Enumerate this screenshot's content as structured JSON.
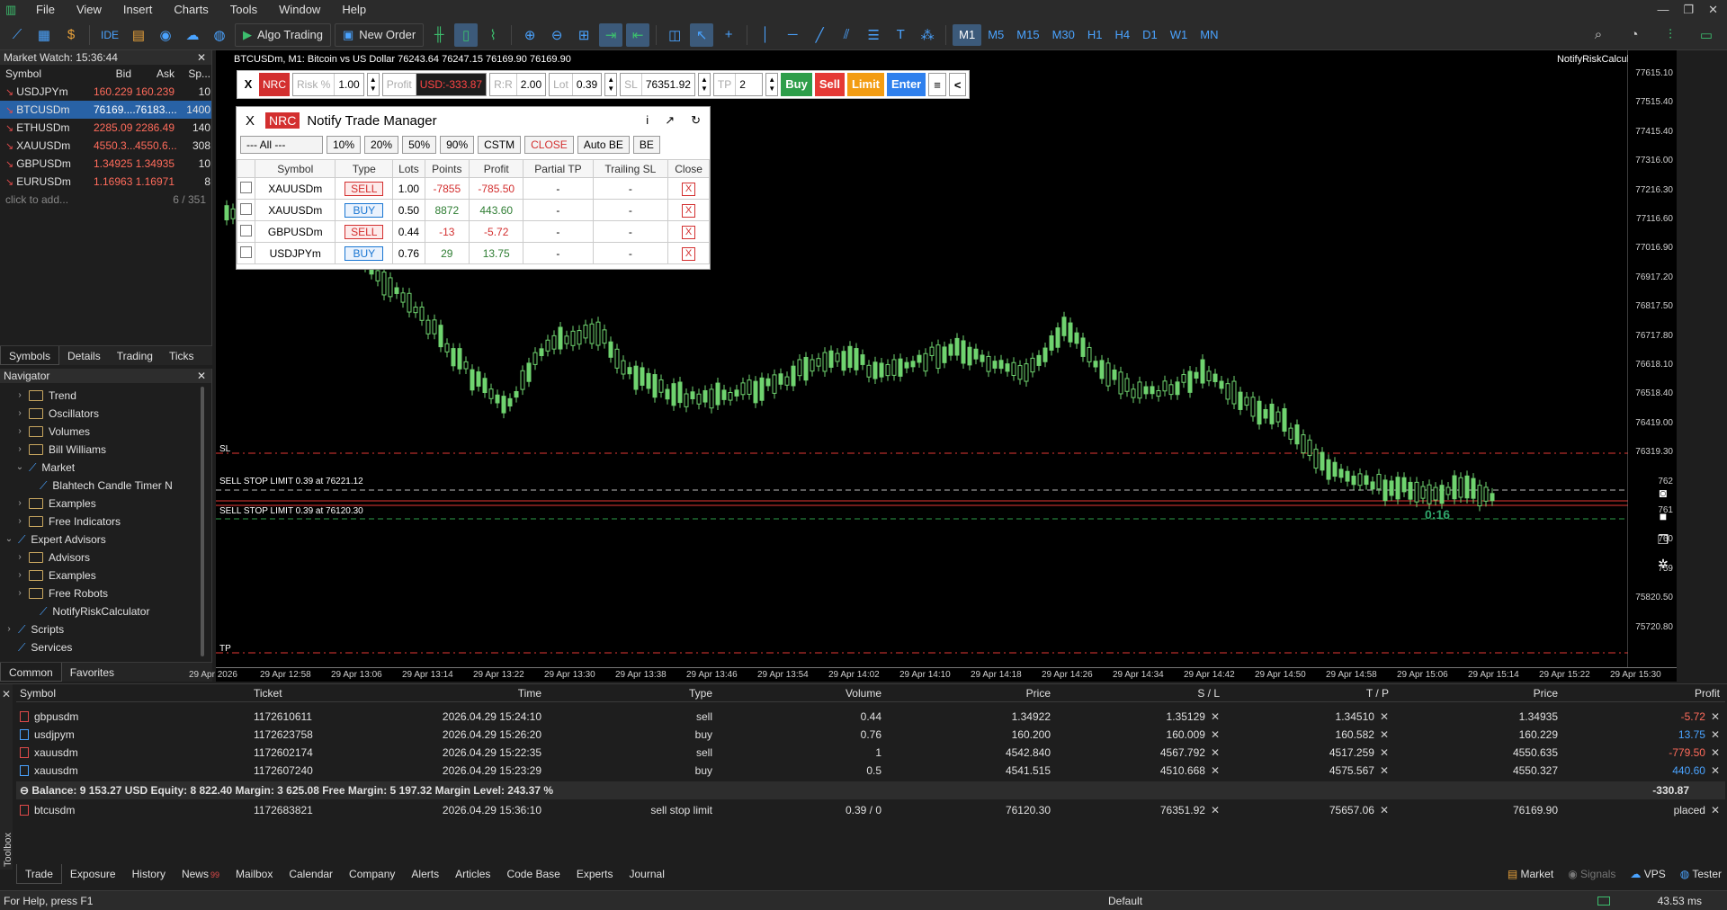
{
  "menu": [
    "File",
    "View",
    "Insert",
    "Charts",
    "Tools",
    "Window",
    "Help"
  ],
  "toolbar": {
    "ide": "IDE",
    "algo_trading": "Algo Trading",
    "new_order": "New Order",
    "timeframes": [
      "M1",
      "M5",
      "M15",
      "M30",
      "H1",
      "H4",
      "D1",
      "W1",
      "MN"
    ],
    "active_tf": "M1"
  },
  "market_watch": {
    "title": "Market Watch: 15:36:44",
    "columns": [
      "Symbol",
      "Bid",
      "Ask",
      "Sp..."
    ],
    "rows": [
      {
        "symbol": "USDJPYm",
        "bid": "160.229",
        "ask": "160.239",
        "spread": "10"
      },
      {
        "symbol": "BTCUSDm",
        "bid": "76169....",
        "ask": "76183....",
        "spread": "1400"
      },
      {
        "symbol": "ETHUSDm",
        "bid": "2285.09",
        "ask": "2286.49",
        "spread": "140"
      },
      {
        "symbol": "XAUUSDm",
        "bid": "4550.3...",
        "ask": "4550.6...",
        "spread": "308"
      },
      {
        "symbol": "GBPUSDm",
        "bid": "1.34925",
        "ask": "1.34935",
        "spread": "10"
      },
      {
        "symbol": "EURUSDm",
        "bid": "1.16963",
        "ask": "1.16971",
        "spread": "8"
      }
    ],
    "add_label": "click to add...",
    "count": "6 / 351",
    "tabs": [
      "Symbols",
      "Details",
      "Trading",
      "Ticks"
    ]
  },
  "navigator": {
    "title": "Navigator",
    "items": [
      {
        "label": "Trend",
        "level": 2,
        "kind": "folder",
        "chev": "›"
      },
      {
        "label": "Oscillators",
        "level": 2,
        "kind": "folder",
        "chev": "›"
      },
      {
        "label": "Volumes",
        "level": 2,
        "kind": "folder",
        "chev": "›"
      },
      {
        "label": "Bill Williams",
        "level": 2,
        "kind": "folder",
        "chev": "›"
      },
      {
        "label": "Market",
        "level": 2,
        "kind": "indicator",
        "chev": "⌄"
      },
      {
        "label": "Blahtech Candle Timer N",
        "level": 3,
        "kind": "indicator",
        "chev": ""
      },
      {
        "label": "Examples",
        "level": 2,
        "kind": "folder",
        "chev": "›"
      },
      {
        "label": "Free Indicators",
        "level": 2,
        "kind": "folder",
        "chev": "›"
      },
      {
        "label": "Expert Advisors",
        "level": 1,
        "kind": "indicator",
        "chev": "⌄"
      },
      {
        "label": "Advisors",
        "level": 2,
        "kind": "folder",
        "chev": "›"
      },
      {
        "label": "Examples",
        "level": 2,
        "kind": "folder",
        "chev": "›"
      },
      {
        "label": "Free Robots",
        "level": 2,
        "kind": "folder",
        "chev": "›"
      },
      {
        "label": "NotifyRiskCalculator",
        "level": 3,
        "kind": "indicator",
        "chev": ""
      },
      {
        "label": "Scripts",
        "level": 1,
        "kind": "indicator",
        "chev": "›"
      },
      {
        "label": "Services",
        "level": 1,
        "kind": "indicator",
        "chev": ""
      }
    ],
    "tabs": [
      "Common",
      "Favorites"
    ]
  },
  "chart": {
    "title": "BTCUSDm, M1:  Bitcoin vs US Dollar  76243.64 76247.15 76169.90 76169.90",
    "ea_label": "NotifyRiskCalculator",
    "price_ticks": [
      "77615.10",
      "77515.40",
      "77415.40",
      "77316.00",
      "77216.30",
      "77116.60",
      "77016.90",
      "76917.20",
      "76817.50",
      "76717.80",
      "76618.10",
      "76518.40",
      "76419.00",
      "76319.30",
      "762",
      "761",
      "760",
      "759",
      "75820.50",
      "75720.80"
    ],
    "time_ticks": [
      "29 Apr 2026",
      "29 Apr 12:58",
      "29 Apr 13:06",
      "29 Apr 13:14",
      "29 Apr 13:22",
      "29 Apr 13:30",
      "29 Apr 13:38",
      "29 Apr 13:46",
      "29 Apr 13:54",
      "29 Apr 14:02",
      "29 Apr 14:10",
      "29 Apr 14:18",
      "29 Apr 14:26",
      "29 Apr 14:34",
      "29 Apr 14:42",
      "29 Apr 14:50",
      "29 Apr 14:58",
      "29 Apr 15:06",
      "29 Apr 15:14",
      "29 Apr 15:22",
      "29 Apr 15:30"
    ],
    "sl_label": "SL",
    "sell_stop_1": "SELL STOP LIMIT 0.39 at 76221.12",
    "sell_stop_2": "SELL STOP LIMIT 0.39 at 76120.30",
    "tp_label": "TP",
    "countdown": "0:16"
  },
  "nrc": {
    "close": "X",
    "logo": "NRC",
    "risk_label": "Risk %",
    "risk_value": "1.00",
    "profit_label": "Profit",
    "profit_value": "USD:-333.87",
    "rr_label": "R:R",
    "rr_value": "2.00",
    "lot_label": "Lot",
    "lot_value": "0.39",
    "sl_label": "SL",
    "sl_value": "76351.92",
    "tp_label": "TP",
    "tp_value": "2",
    "buy": "Buy",
    "sell": "Sell",
    "limit": "Limit",
    "enter": "Enter",
    "menu": "≡",
    "collapse": "<",
    "colors": {
      "buy": "#2e9e4a",
      "sell": "#e53935",
      "limit": "#f39c12",
      "enter": "#2f80ed"
    }
  },
  "trade_manager": {
    "close": "X",
    "logo": "NRC",
    "title": "Notify Trade Manager",
    "icons": [
      "i",
      "↗",
      "↻"
    ],
    "filters": [
      "--- All ---",
      "10%",
      "20%",
      "50%",
      "90%",
      "CSTM",
      "CLOSE",
      "Auto BE",
      "BE"
    ],
    "columns": [
      "",
      "Symbol",
      "Type",
      "Lots",
      "Points",
      "Profit",
      "Partial TP",
      "Trailing SL",
      "Close"
    ],
    "rows": [
      {
        "symbol": "XAUUSDm",
        "type": "SELL",
        "lots": "1.00",
        "points": "-7855",
        "profit": "-785.50",
        "partial": "-",
        "trailing": "-",
        "close": "X"
      },
      {
        "symbol": "XAUUSDm",
        "type": "BUY",
        "lots": "0.50",
        "points": "8872",
        "profit": "443.60",
        "partial": "-",
        "trailing": "-",
        "close": "X"
      },
      {
        "symbol": "GBPUSDm",
        "type": "SELL",
        "lots": "0.44",
        "points": "-13",
        "profit": "-5.72",
        "partial": "-",
        "trailing": "-",
        "close": "X"
      },
      {
        "symbol": "USDJPYm",
        "type": "BUY",
        "lots": "0.76",
        "points": "29",
        "profit": "13.75",
        "partial": "-",
        "trailing": "-",
        "close": "X"
      }
    ]
  },
  "toolbox": {
    "side_label": "Toolbox",
    "columns": [
      "Symbol",
      "Ticket",
      "Time",
      "Type",
      "Volume",
      "Price",
      "S / L",
      "T / P",
      "Price",
      "Profit"
    ],
    "rows": [
      {
        "symbol": "gbpusdm",
        "ticket": "1172610611",
        "time": "2026.04.29 15:24:10",
        "type": "sell",
        "volume": "0.44",
        "price": "1.34922",
        "sl": "1.35129",
        "tp": "1.34510",
        "cur": "1.34935",
        "profit": "-5.72"
      },
      {
        "symbol": "usdjpym",
        "ticket": "1172623758",
        "time": "2026.04.29 15:26:20",
        "type": "buy",
        "volume": "0.76",
        "price": "160.200",
        "sl": "160.009",
        "tp": "160.582",
        "cur": "160.229",
        "profit": "13.75"
      },
      {
        "symbol": "xauusdm",
        "ticket": "1172602174",
        "time": "2026.04.29 15:22:35",
        "type": "sell",
        "volume": "1",
        "price": "4542.840",
        "sl": "4567.792",
        "tp": "4517.259",
        "cur": "4550.635",
        "profit": "-779.50"
      },
      {
        "symbol": "xauusdm",
        "ticket": "1172607240",
        "time": "2026.04.29 15:23:29",
        "type": "buy",
        "volume": "0.5",
        "price": "4541.515",
        "sl": "4510.668",
        "tp": "4575.567",
        "cur": "4550.327",
        "profit": "440.60"
      }
    ],
    "balance_line": "Balance: 9 153.27 USD  Equity: 8 822.40  Margin: 3 625.08  Free Margin: 5 197.32  Margin Level: 243.37 %",
    "balance_total": "-330.87",
    "pending": {
      "symbol": "btcusdm",
      "ticket": "1172683821",
      "time": "2026.04.29 15:36:10",
      "type": "sell stop limit",
      "volume": "0.39 / 0",
      "price": "76120.30",
      "sl": "76351.92",
      "tp": "75657.06",
      "cur": "76169.90",
      "profit": "placed"
    },
    "tabs": [
      "Trade",
      "Exposure",
      "History",
      "News",
      "Mailbox",
      "Calendar",
      "Company",
      "Alerts",
      "Articles",
      "Code Base",
      "Experts",
      "Journal"
    ],
    "news_badge": "99",
    "right": [
      "Market",
      "Signals",
      "VPS",
      "Tester"
    ]
  },
  "status": {
    "help": "For Help, press F1",
    "profile": "Default",
    "ping": "43.53 ms"
  }
}
